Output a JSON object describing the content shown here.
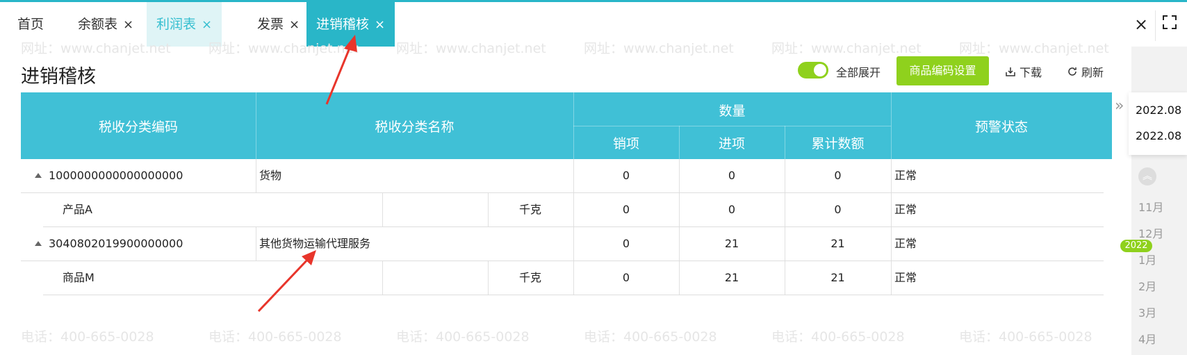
{
  "tabs": [
    {
      "label": "首页",
      "closable": false
    },
    {
      "label": "余额表",
      "closable": true
    },
    {
      "label": "利润表",
      "closable": true
    },
    {
      "label": "发票",
      "closable": true
    },
    {
      "label": "进销稽核",
      "closable": true,
      "active": true
    }
  ],
  "close_glyph": "×",
  "window": {
    "close_icon": "close-icon",
    "fullscreen_icon": "fullscreen-icon"
  },
  "page": {
    "title": "进销稽核",
    "expand_all_label": "全部展开",
    "expand_all_on": true,
    "code_settings_button": "商品编码设置",
    "download_label": "下载",
    "refresh_label": "刷新"
  },
  "table": {
    "headers": {
      "code": "税收分类编码",
      "name": "税收分类名称",
      "quantity": "数量",
      "sales": "销项",
      "purchase": "进项",
      "cumulative": "累计数额",
      "warning": "预警状态"
    },
    "rows": [
      {
        "type": "group",
        "code": "1000000000000000000",
        "name": "货物",
        "sales": "0",
        "purchase": "0",
        "cumulative": "0",
        "status": "正常"
      },
      {
        "type": "item",
        "name": "产品A",
        "unit": "千克",
        "sales": "0",
        "purchase": "0",
        "cumulative": "0",
        "status": "正常"
      },
      {
        "type": "group",
        "code": "3040802019900000000",
        "name": "其他货物运输代理服务",
        "sales": "0",
        "purchase": "21",
        "cumulative": "21",
        "status": "正常"
      },
      {
        "type": "item",
        "name": "商品M",
        "unit": "千克",
        "sales": "0",
        "purchase": "21",
        "cumulative": "21",
        "status": "正常"
      }
    ]
  },
  "period": {
    "start": "2022.08",
    "end": "2022.08",
    "year_badge": "2022",
    "months": [
      "11月",
      "12月",
      "1月",
      "2月",
      "3月",
      "4月"
    ]
  },
  "watermark": {
    "phone": "电话：400-665-0028",
    "site": "网址：www.chanjet.net"
  },
  "colors": {
    "header_bg": "#40c0d6",
    "accent": "#29b6c8",
    "green": "#8fd11d",
    "arrow": "#e8352b"
  }
}
